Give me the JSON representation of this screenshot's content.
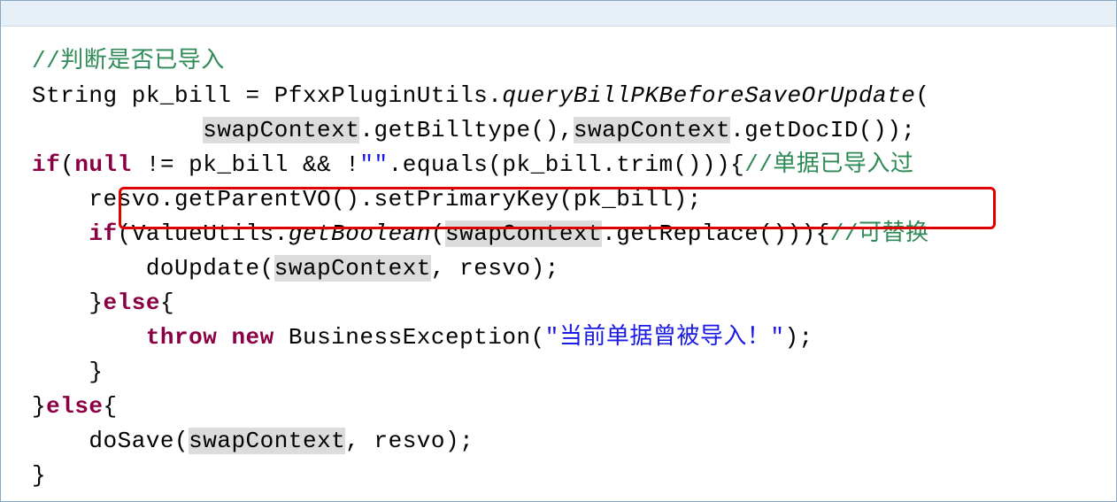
{
  "code": {
    "line1": {
      "comment": "//判断是否已导入"
    },
    "line2": {
      "a": "String pk_bill = PfxxPluginUtils.",
      "m": "queryBillPKBeforeSaveOrUpdate",
      "b": "("
    },
    "line3": {
      "indent": "            ",
      "sc1": "swapContext",
      "a": ".getBilltype(),",
      "sc2": "swapContext",
      "b": ".getDocID());"
    },
    "line4": {
      "kw_if": "if",
      "a": "(",
      "kw_null": "null",
      "b": " != pk_bill && !",
      "str_empty": "\"\"",
      "c": ".equals(pk_bill.trim())){",
      "cm": "//单据已导入过"
    },
    "line5": {
      "indent": "    ",
      "a": "resvo.getParentVO().setPrimaryKey(pk_bill);"
    },
    "line6": {
      "indent": "    ",
      "kw_if": "if",
      "a": "(ValueUtils.",
      "m": "getBoolean",
      "b": "(",
      "sc": "swapContext",
      "c": ".getReplace())){",
      "cm": "//可替换"
    },
    "line7": {
      "indent": "        ",
      "a": "doUpdate(",
      "sc": "swapContext",
      "b": ", resvo);"
    },
    "line8": {
      "indent": "    ",
      "a": "}",
      "kw_else": "else",
      "b": "{"
    },
    "line9": {
      "indent": "        ",
      "kw_throw": "throw",
      "sp": " ",
      "kw_new": "new",
      "a": " BusinessException(",
      "str": "\"当前单据曾被导入！\"",
      "b": ");"
    },
    "line10": {
      "indent": "    ",
      "a": "}"
    },
    "line11": {
      "a": "}",
      "kw_else": "else",
      "b": "{"
    },
    "line12": {
      "indent": "    ",
      "a": "doSave(",
      "sc": "swapContext",
      "b": ", resvo);"
    },
    "line13": {
      "a": "}"
    }
  }
}
